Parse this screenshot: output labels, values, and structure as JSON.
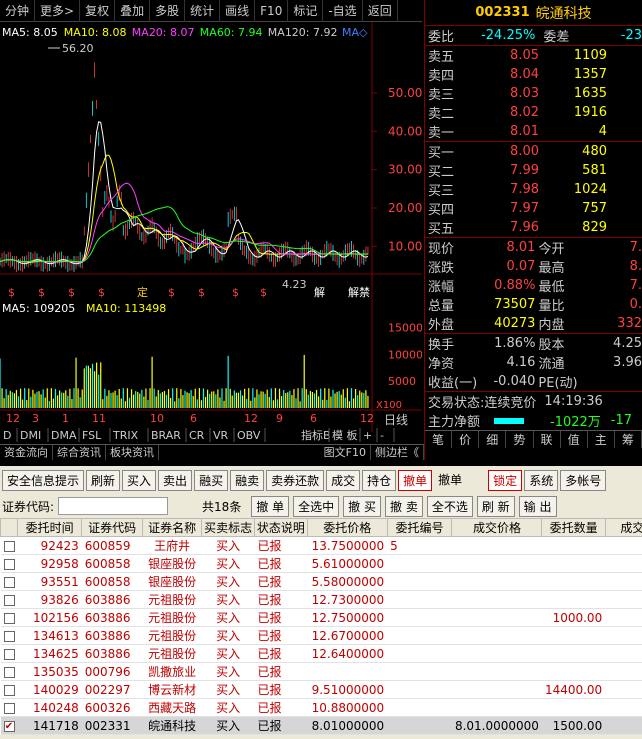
{
  "topbar": {
    "items": [
      "分钟",
      "更多>",
      "复权",
      "叠加",
      "多股",
      "统计",
      "画线",
      "F10",
      "标记",
      "-自选",
      "返回"
    ]
  },
  "ma": {
    "ma5": "MA5: 8.05",
    "ma10": "MA10: 8.08",
    "ma20": "MA20: 8.07",
    "ma60": "MA60: 7.94",
    "ma120": "MA120: 7.92",
    "mam": "MA◇"
  },
  "price_axis": [
    "50.00",
    "40.00",
    "30.00",
    "20.00",
    "10.00"
  ],
  "high_label": "56.20",
  "low_label": "4.23",
  "markers": [
    "定",
    "解",
    "解禁"
  ],
  "vol": {
    "ma5": "MA5: 109205",
    "ma10": "MA10: 113498",
    "axis": [
      "15000",
      "10000",
      "5000"
    ],
    "unit": "X100"
  },
  "xaxis": [
    "12",
    "3",
    "1",
    "11",
    "10",
    "6",
    "12",
    "9",
    "6",
    "12"
  ],
  "xaxis_end": "日线",
  "indicator_tabs": [
    "D",
    "DMI",
    "DMA",
    "FSL",
    "TRIX",
    "BRAR",
    "CR",
    "VR",
    "OBV",
    "指标B",
    "模 板",
    "+",
    "-"
  ],
  "stock": {
    "code": "002331",
    "name": "皖通科技"
  },
  "weibi": {
    "label": "委比",
    "value": "-24.25%",
    "label2": "委差",
    "value2": "-23"
  },
  "asks": [
    {
      "l": "卖五",
      "p": "8.05",
      "v": "1109"
    },
    {
      "l": "卖四",
      "p": "8.04",
      "v": "1357"
    },
    {
      "l": "卖三",
      "p": "8.03",
      "v": "1635"
    },
    {
      "l": "卖二",
      "p": "8.02",
      "v": "1916"
    },
    {
      "l": "卖一",
      "p": "8.01",
      "v": "4"
    }
  ],
  "bids": [
    {
      "l": "买一",
      "p": "8.00",
      "v": "480"
    },
    {
      "l": "买二",
      "p": "7.99",
      "v": "581"
    },
    {
      "l": "买三",
      "p": "7.98",
      "v": "1024"
    },
    {
      "l": "买四",
      "p": "7.97",
      "v": "757"
    },
    {
      "l": "买五",
      "p": "7.96",
      "v": "829"
    }
  ],
  "quote": [
    {
      "l1": "现价",
      "v1": "8.01",
      "l2": "今开",
      "v2": "7."
    },
    {
      "l1": "涨跌",
      "v1": "0.07",
      "l2": "最高",
      "v2": "8."
    },
    {
      "l1": "涨幅",
      "v1": "0.88%",
      "l2": "最低",
      "v2": "7."
    },
    {
      "l1": "总量",
      "v1": "73507",
      "l2": "量比",
      "v2": "0."
    },
    {
      "l1": "外盘",
      "v1": "40273",
      "l2": "内盘",
      "v2": "332"
    }
  ],
  "quote2": [
    {
      "l1": "换手",
      "v1": "1.86%",
      "l2": "股本",
      "v2": "4.25"
    },
    {
      "l1": "净资",
      "v1": "4.16",
      "l2": "流通",
      "v2": "3.96"
    },
    {
      "l1": "收益(一)",
      "v1": "-0.040",
      "l2": "PE(动)",
      "v2": ""
    }
  ],
  "status": {
    "label": "交易状态:",
    "value": "连续竞价",
    "time": "14:19:36"
  },
  "netflow": {
    "label": "主力净额",
    "value": "-1022万",
    "value2": "-17"
  },
  "rtabs": [
    "笔",
    "价",
    "细",
    "势",
    "联",
    "值",
    "主",
    "筹"
  ],
  "bottom_tabs": [
    "资金流向",
    "综合资讯",
    "板块资讯",
    "图文F10",
    "侧边栏《"
  ],
  "trade": {
    "toolbar": [
      "安全信息提示",
      "刷新",
      "买入",
      "卖出",
      "融买",
      "融卖",
      "卖券还款",
      "成交",
      "持仓",
      "撤单",
      "撤单",
      "锁定",
      "系统",
      "多帐号"
    ],
    "code_label": "证券代码:",
    "count": "共18条",
    "actions": [
      "撤 单",
      "全选中",
      "撤 买",
      "撤 卖",
      "全不选",
      "刷 新",
      "输 出"
    ],
    "cols": [
      "委托时间",
      "证券代码",
      "证券名称",
      "买卖标志",
      "状态说明",
      "委托价格",
      "委托编号",
      "成交价格",
      "委托数量",
      "成交"
    ],
    "rows": [
      [
        "92423",
        "600859",
        "王府井",
        "买入",
        "已报",
        "13.7500000",
        "5",
        "",
        "",
        ""
      ],
      [
        "92958",
        "600858",
        "银座股份",
        "买入",
        "已报",
        "5.61000000",
        "",
        "",
        "",
        ""
      ],
      [
        "93551",
        "600858",
        "银座股份",
        "买入",
        "已报",
        "5.58000000",
        "",
        "",
        "",
        ""
      ],
      [
        "93826",
        "603886",
        "元祖股份",
        "买入",
        "已报",
        "12.7300000",
        "",
        "",
        "",
        ""
      ],
      [
        "102156",
        "603886",
        "元祖股份",
        "买入",
        "已报",
        "12.7500000",
        "",
        "",
        "1000.00",
        ""
      ],
      [
        "134613",
        "603886",
        "元祖股份",
        "买入",
        "已报",
        "12.6700000",
        "",
        "",
        "",
        ""
      ],
      [
        "134625",
        "603886",
        "元祖股份",
        "买入",
        "已报",
        "12.6400000",
        "",
        "",
        "",
        ""
      ],
      [
        "135035",
        "000796",
        "凯撒旅业",
        "买入",
        "已报",
        "",
        "",
        "",
        "",
        ""
      ],
      [
        "140029",
        "002297",
        "博云新材",
        "买入",
        "已报",
        "9.51000000",
        "",
        "",
        "14400.00",
        ""
      ],
      [
        "140248",
        "600326",
        "西藏天路",
        "买入",
        "已报",
        "10.8800000",
        "",
        "",
        "",
        ""
      ],
      [
        "141718",
        "002331",
        "皖通科技",
        "买入",
        "已报",
        "8.01000000",
        "",
        "8.01.0000000",
        "1500.00",
        ""
      ]
    ]
  }
}
